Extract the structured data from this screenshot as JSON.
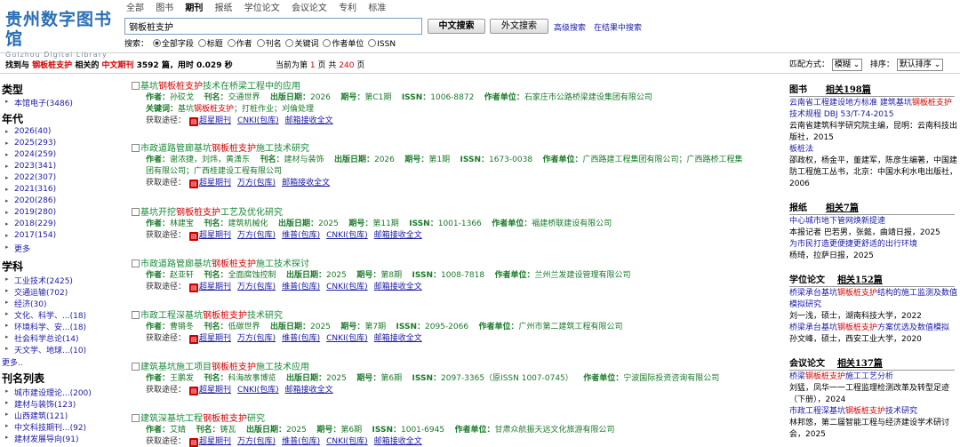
{
  "header": {
    "logo_cn": "贵州数字图书馆",
    "logo_en": "Guizhou Digital Library",
    "nav": [
      "全部",
      "图书",
      "期刊",
      "报纸",
      "学位论文",
      "会议论文",
      "专利",
      "标准"
    ],
    "nav_active": 2,
    "search_value": "钢板桩支护",
    "btn_cn": "中文搜索",
    "btn_foreign": "外文搜索",
    "adv": "高级搜索",
    "in_results": "在结果中搜索",
    "scope_label": "搜索：",
    "scopes": [
      "全部字段",
      "标题",
      "作者",
      "刊名",
      "关键词",
      "作者单位",
      "ISSN"
    ],
    "scope_selected": 0
  },
  "resultbar": {
    "p1": "找到与",
    "kw": "钢板桩支护",
    "p2": "相关的",
    "type": "中文期刊",
    "count": "3592",
    "p3": "篇，用时",
    "time": "0.029",
    "p4": "秒",
    "page_p1": "当前为第",
    "page_cur": "1",
    "page_p2": "页 共",
    "page_total": "240",
    "page_p3": "页",
    "match_label": "匹配方式：",
    "match_val": "模糊",
    "sort_label": "排序：",
    "sort_val": "默认排序"
  },
  "facets": {
    "type_h": "类型",
    "type_items": [
      "本馆电子(3486)"
    ],
    "year_h": "年代",
    "year_items": [
      "2026(40)",
      "2025(293)",
      "2024(259)",
      "2023(341)",
      "2022(307)",
      "2021(316)",
      "2020(286)",
      "2019(280)",
      "2018(229)",
      "2017(154)",
      "更多"
    ],
    "subj_h": "学科",
    "subj_items": [
      "工业技术(2425)",
      "交通运输(702)",
      "经济(30)",
      "文化、科学、...(18)",
      "环境科学、安...(18)",
      "社会科学总论(14)",
      "天文学、地球...(10)"
    ],
    "subj_more": "更多..",
    "jour_h": "刊名列表",
    "jour_items": [
      "城市建设理论...(200)",
      "建材与装饰(123)",
      "山西建筑(121)",
      "中文科技期刊...(92)",
      "建材发展导向(91)"
    ]
  },
  "results": [
    {
      "t_pre": "基坑",
      "t_kw": "钢板桩支护",
      "t_post": "技术在桥梁工程中的应用",
      "author": "孙砹戈",
      "journal": "交通世界",
      "date": "2026",
      "issue": "第C1期",
      "issn": "1006-8872",
      "org": "石家庄市公路桥梁建设集团有限公司",
      "kw_pre": "基坑",
      "kw_kw": "钢板桩支护",
      "kw_post": "；打桩作业；刈倫处理",
      "links": [
        "超星期刊",
        "CNKI(包库)",
        "邮箱接收全文"
      ]
    },
    {
      "t_pre": "市政道路管廊基坑",
      "t_kw": "钢板桩支护",
      "t_post": "施工技术研究",
      "author": "谢浓捷，刘炜，黄潇东",
      "journal": "建材与装饰",
      "date": "2026",
      "issue": "第1期",
      "issn": "1673-0038",
      "org": "广西路建工程集团有限公司；广西路桥工程集",
      "org2": "团有限公司；广西桂建设工程有限公司",
      "links": [
        "超星期刊",
        "万方(包库)",
        "邮箱接收全文"
      ]
    },
    {
      "t_pre": "基坑开挖",
      "t_kw": "钢板桩支护",
      "t_post": "工艺及优化研究",
      "author": "林建宝",
      "journal": "建筑机械化",
      "date": "2025",
      "issue": "第11期",
      "issn": "1001-1366",
      "org": "福建桥联建设有限公司",
      "links": [
        "超星期刊",
        "万方(包库)",
        "维普(包库)",
        "CNKI(包库)",
        "邮箱接收全文"
      ]
    },
    {
      "t_pre": "市政道路管廊基坑",
      "t_kw": "钢板桩支护",
      "t_post": "施工技术探讨",
      "author": "赵亚轩",
      "journal": "全面腐蚀控制",
      "date": "2025",
      "issue": "第8期",
      "issn": "1008-7818",
      "org": "兰州兰发建设管理有限公司",
      "links": [
        "超星期刊",
        "万方(包库)",
        "维普(包库)",
        "CNKI(包库)",
        "邮箱接收全文"
      ]
    },
    {
      "t_pre": "市政工程深基坑",
      "t_kw": "钢板桩支护",
      "t_post": "技术研究",
      "author": "曹锵冬",
      "journal": "低碳世界",
      "date": "2025",
      "issue": "第7期",
      "issn": "2095-2066",
      "org": "广州市第二建筑工程有限公司",
      "links": [
        "超星期刊",
        "万方(包库)",
        "维普(包库)",
        "CNKI(包库)",
        "邮箱接收全文"
      ]
    },
    {
      "t_pre": "建筑基坑施工项目",
      "t_kw": "钢板桩支护",
      "t_post": "施工技术应用",
      "author": "王鹏发",
      "journal": "科海故事博览",
      "date": "2025",
      "issue": "第6期",
      "issn": "2097-3365（原ISSN 1007-0745）",
      "org": "宁波国际投资咨询有限公司",
      "links": [
        "超星期刊",
        "CNKI(包库)",
        "邮箱接收全文"
      ]
    },
    {
      "t_pre": "建筑深基坑工程",
      "t_kw": "钢板桩支护",
      "t_post": "研究",
      "author": "艾婧",
      "journal": "铸瓦",
      "date": "2025",
      "issue": "第6期",
      "issn": "1001-6945",
      "org": "甘肃众航振天远文化旅游有限公司",
      "links": [
        "超星期刊",
        "万方(包库)",
        "维普(包库)",
        "CNKI(包库)",
        "邮箱接收全文"
      ]
    }
  ],
  "labels": {
    "author": "作者：",
    "journal": "刊名：",
    "date": "出版日期：",
    "issue": "期号：",
    "issn": "ISSN：",
    "org": "作者单位：",
    "keywords": "关键词：",
    "acquire": "获取途径："
  },
  "right": {
    "books_h": "图书",
    "books_n": "相关198篇",
    "books_1a": "云南省工程建设地方标准 建筑基坑",
    "books_1kw": "钢板桩支护",
    "books_1b": "技术规程 DBJ 53/T-74-2015",
    "books_1c": "云南省建筑科学研究院主编，昆明：云南科技出",
    "books_1d": "版社，2015",
    "books_2a": "板桩法",
    "books_2b": "邵政权，杨金平，董建军，陈彦生编著，中国建",
    "books_2c": "防工程施工丛书，北京：中国水利水电出版社，",
    "books_2d": "2006",
    "news_h": "报纸",
    "news_n": "相关7篇",
    "news_1": "中心城市地下管网焕新提速",
    "news_1b": "本报记者 巴若男，张懿，曲靖日报，2025",
    "news_2": "为市民打造更便捷更舒适的出行环境",
    "news_2b": "杨琦，拉萨日报，2025",
    "thesis_h": "学位论文",
    "thesis_n": "相关152篇",
    "thesis_1a": "桥梁承台基坑",
    "thesis_1kw": "钢板桩支护",
    "thesis_1b": "结构的施工监测及数值",
    "thesis_1c": "模拟研究",
    "thesis_1d": "刘一浅，硕士，湖南科技大学，2022",
    "thesis_2a": "桥梁承台基坑",
    "thesis_2kw": "钢板桩支护",
    "thesis_2b": "方案优选及数值模拟",
    "thesis_2c": "孙文峰，硕士，西安工业大学，2020",
    "conf_h": "会议论文",
    "conf_n": "相关137篇",
    "conf_1a": "桥梁",
    "conf_1kw": "钢板桩支护",
    "conf_1b": "施工工艺分析",
    "conf_1c": "刘猛，凤华一一工程监理检测改革及转型足迹",
    "conf_1d": "（下册），2024",
    "conf_2a": "市政工程深基坑",
    "conf_2kw": "钢板桩支护",
    "conf_2b": "技术研究",
    "conf_2c": "林邦悠，第二届智能工程与经济建设学术研讨",
    "conf_2d": "会，2025"
  }
}
